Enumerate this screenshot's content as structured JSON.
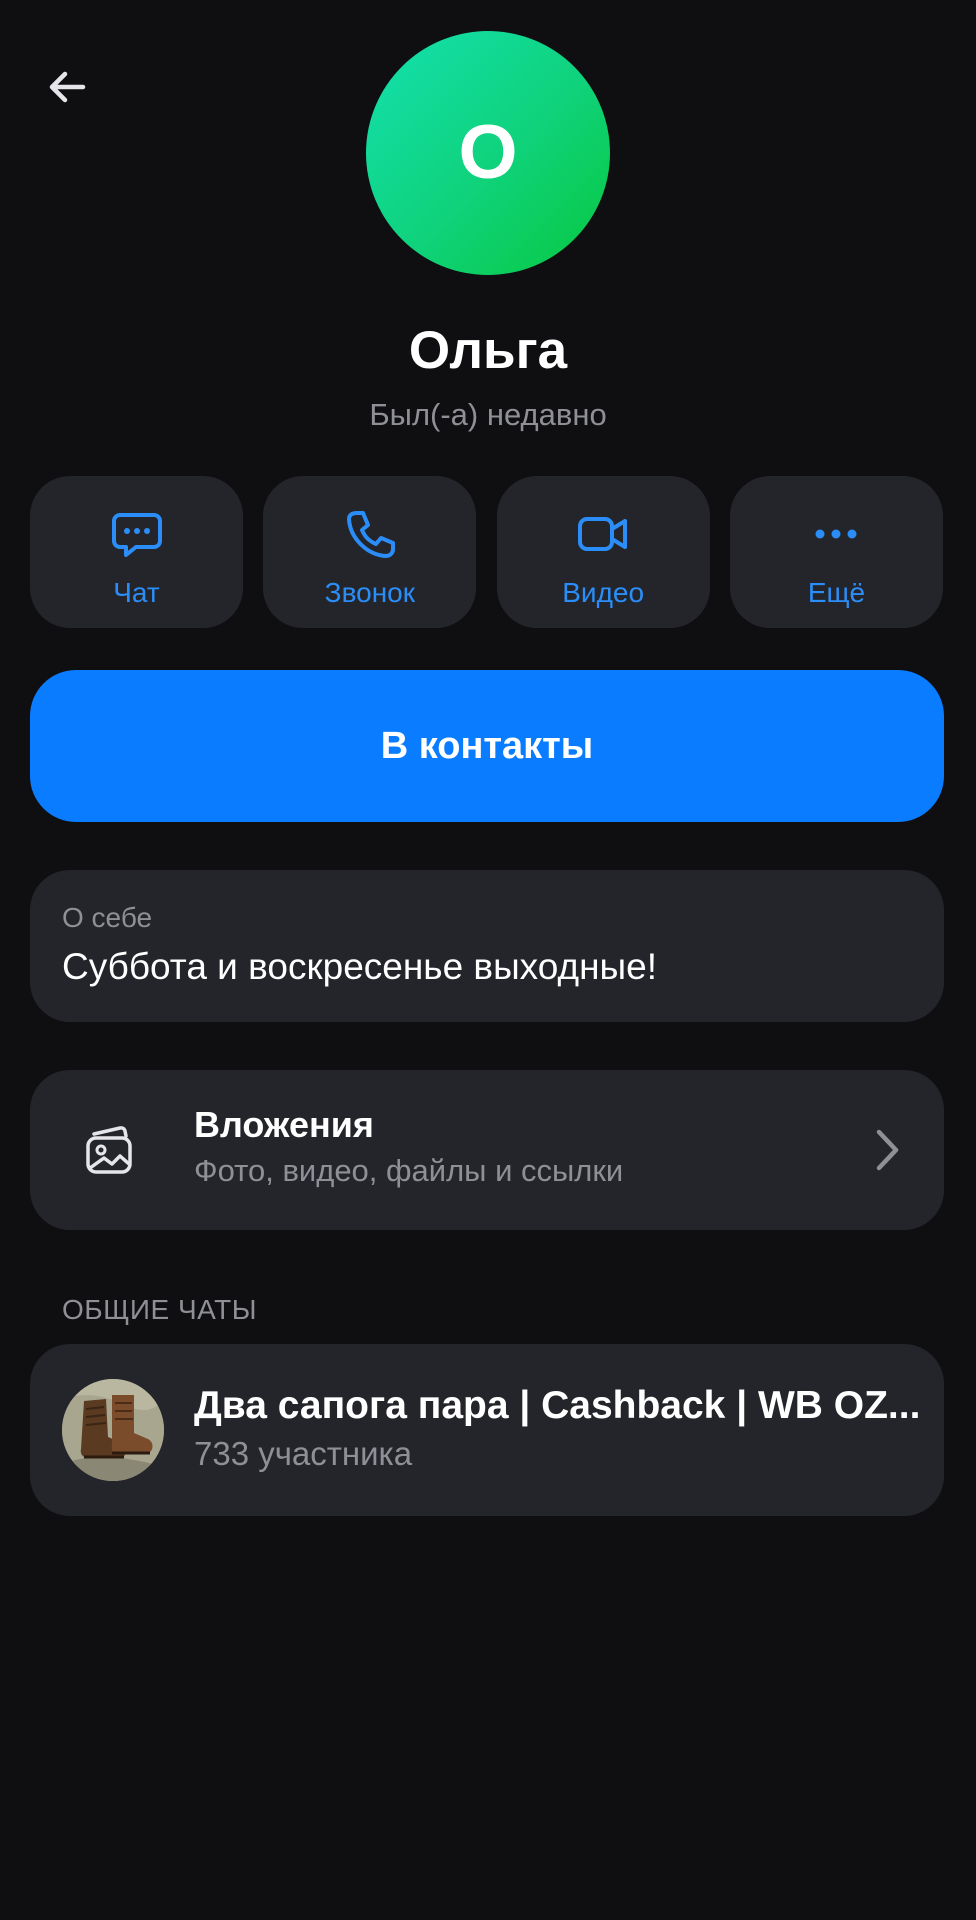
{
  "header": {
    "back_icon": "arrow-left-icon"
  },
  "profile": {
    "avatar_letter": "О",
    "avatar_colors": [
      "#14e0b0",
      "#07c83e"
    ],
    "name": "Ольга",
    "status": "Был(-а) недавно"
  },
  "actions": [
    {
      "label": "Чат",
      "icon": "chat-bubble-icon"
    },
    {
      "label": "Звонок",
      "icon": "phone-icon"
    },
    {
      "label": "Видео",
      "icon": "video-camera-icon"
    },
    {
      "label": "Ещё",
      "icon": "more-dots-icon"
    }
  ],
  "add_contact": {
    "label": "В контакты"
  },
  "about": {
    "label": "О себе",
    "text": "Суббота и воскресенье выходные!"
  },
  "attachments": {
    "title": "Вложения",
    "subtitle": "Фото, видео, файлы и ссылки",
    "icon": "media-gallery-icon"
  },
  "common_chats": {
    "header": "ОБЩИЕ ЧАТЫ",
    "items": [
      {
        "title": "Два сапога пара | Cashback | WB OZ...",
        "subtitle": "733 участника",
        "avatar_icon": "boots-image"
      }
    ]
  },
  "colors": {
    "background": "#0f0f12",
    "card": "#24252b",
    "accent": "#0a7cff",
    "accent_text": "#2b8ef8",
    "secondary_text": "#8f9096"
  }
}
